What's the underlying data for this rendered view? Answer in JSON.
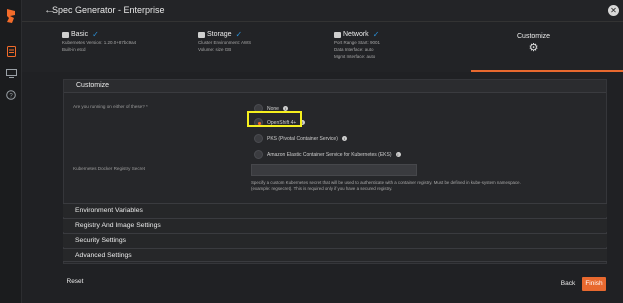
{
  "header": {
    "back_glyph": "←",
    "title": "Spec Generator - Enterprise",
    "close_glyph": "✕"
  },
  "sidebar": {
    "logo": "portworx-logo",
    "icons": [
      "document-icon",
      "monitor-icon",
      "help-icon"
    ]
  },
  "steps": [
    {
      "title": "Basic",
      "lines": [
        "Kubernetes Version: 1.20.0+87bc9a4",
        "Built-in etcd"
      ],
      "checked": true
    },
    {
      "title": "Storage",
      "lines": [
        "Cluster Environment: AWS",
        "Volume: size GB"
      ],
      "checked": true
    },
    {
      "title": "Network",
      "lines": [
        "Port Range Start: 9001",
        "Data Interface: auto",
        "Mgmt Interface: auto"
      ],
      "checked": true
    },
    {
      "title": "Customize",
      "lines": [],
      "checked": false
    }
  ],
  "step_check_glyph": "✓",
  "gear_glyph": "⚙",
  "customize": {
    "heading": "Customize",
    "question": "Are you running on either of these? *",
    "options": [
      {
        "label": "None",
        "selected": false
      },
      {
        "label": "OpenShift 4+",
        "selected": true
      },
      {
        "label": "PKS (Pivotal Container Service)",
        "selected": false
      },
      {
        "label": "Amazon Elastic Container Service for Kubernetes (EKS)",
        "selected": false
      }
    ],
    "info_glyph": "i",
    "secret_label": "Kubernetes Docker Registry Secret",
    "secret_value": "",
    "secret_help": "Specify a custom Kubernetes secret that will be used to authenticate with a container registry. Must be defined in kube-system namespace. (example: regsecret). This is required only if you have a secured registry."
  },
  "sections": [
    "Environment Variables",
    "Registry And Image Settings",
    "Security Settings",
    "Advanced Settings"
  ],
  "footer": {
    "reset": "Reset",
    "back": "Back",
    "finish": "Finish"
  },
  "colors": {
    "accent": "#e8692f",
    "highlight": "#f5ef1e",
    "check": "#2a8fd6"
  }
}
